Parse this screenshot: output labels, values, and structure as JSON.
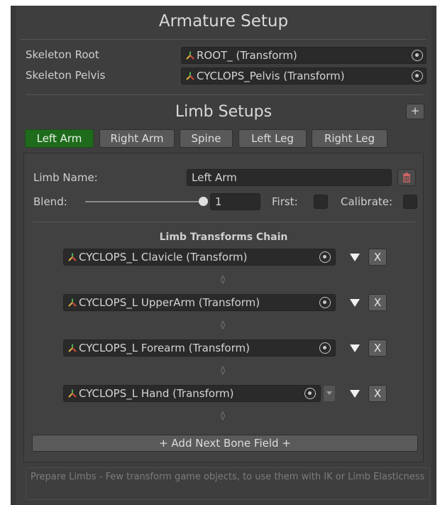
{
  "header": {
    "title": "Armature Setup"
  },
  "skeleton": {
    "root_label": "Skeleton Root",
    "root_value": "ROOT_ (Transform)",
    "pelvis_label": "Skeleton Pelvis",
    "pelvis_value": "CYCLOPS_Pelvis (Transform)"
  },
  "limb_setups": {
    "title": "Limb Setups",
    "add_label": "+",
    "tabs": [
      {
        "label": "Left Arm",
        "active": true
      },
      {
        "label": "Right Arm",
        "active": false
      },
      {
        "label": "Spine",
        "active": false
      },
      {
        "label": "Left Leg",
        "active": false
      },
      {
        "label": "Right Leg",
        "active": false
      }
    ]
  },
  "limb": {
    "name_label": "Limb Name:",
    "name_value": "Left Arm",
    "blend_label": "Blend:",
    "blend_value": "1",
    "first_label": "First:",
    "calibrate_label": "Calibrate:",
    "chain_title": "Limb Transforms Chain",
    "chain": [
      {
        "value": "CYCLOPS_L Clavicle (Transform)",
        "remove": "X"
      },
      {
        "value": "CYCLOPS_L UpperArm (Transform)",
        "remove": "X"
      },
      {
        "value": "CYCLOPS_L Forearm (Transform)",
        "remove": "X"
      },
      {
        "value": "CYCLOPS_L Hand (Transform)",
        "remove": "X"
      }
    ],
    "separator_glyph": "◊",
    "add_bone_label": "+ Add Next Bone Field +"
  },
  "help": {
    "text": "Prepare Limbs - Few transform game objects, to use them with IK or Limb Elasticness"
  },
  "colors": {
    "active_tab": "#1f6b1c",
    "panel": "#3e3e3e",
    "field": "#2a2a2a"
  },
  "icons": {
    "transform": "transform-icon",
    "picker": "object-picker-icon",
    "trash": "trash-icon",
    "arrow": "arrow-down-icon"
  }
}
